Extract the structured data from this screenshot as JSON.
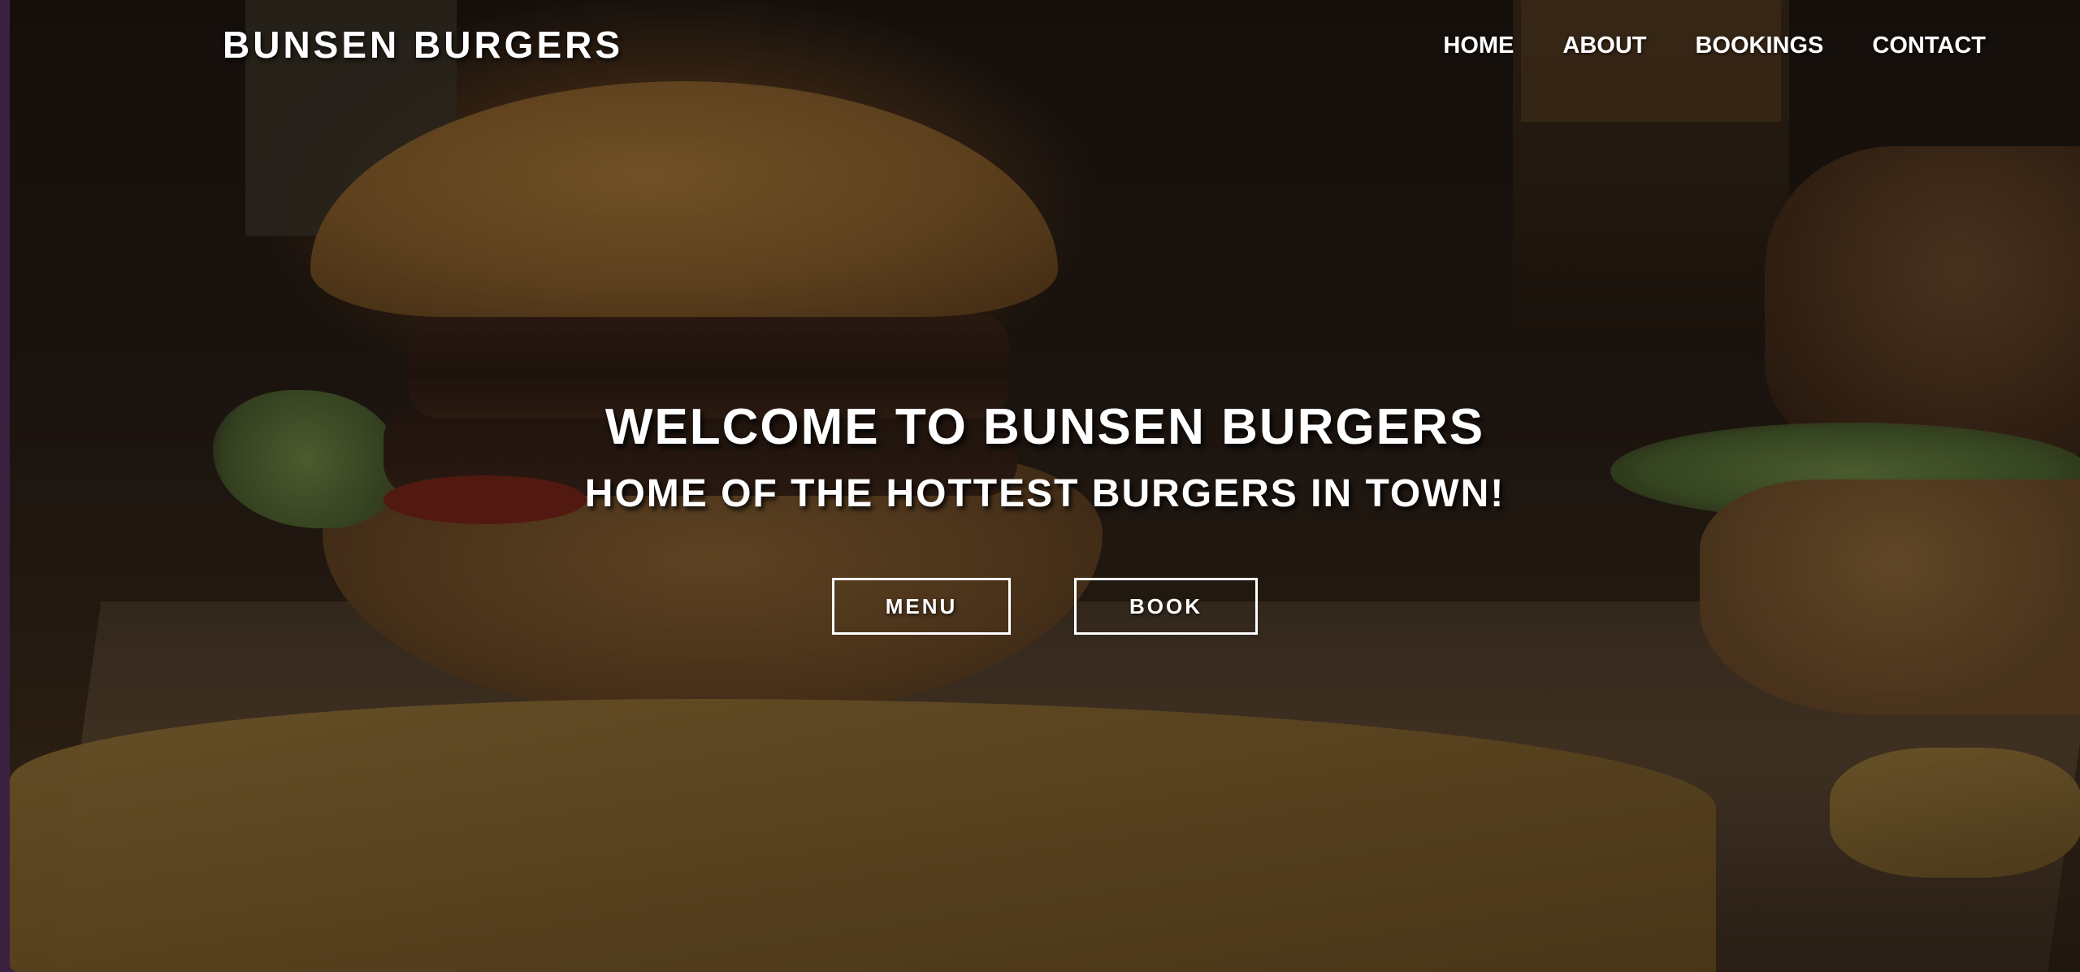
{
  "brand": {
    "name": "BUNSEN BURGERS"
  },
  "nav": {
    "items": [
      {
        "label": "HOME"
      },
      {
        "label": "ABOUT"
      },
      {
        "label": "BOOKINGS"
      },
      {
        "label": "CONTACT"
      }
    ]
  },
  "hero": {
    "headline": "WELCOME TO BUNSEN BURGERS",
    "subheadline": "HOME OF THE HOTTEST BURGERS IN TOWN!",
    "background_image": "burger-and-fries-photo",
    "buttons": {
      "menu_label": "MENU",
      "book_label": "BOOK"
    }
  },
  "colors": {
    "text": "#ffffff",
    "button_border": "#ffffff",
    "overlay": "#0a0604"
  }
}
